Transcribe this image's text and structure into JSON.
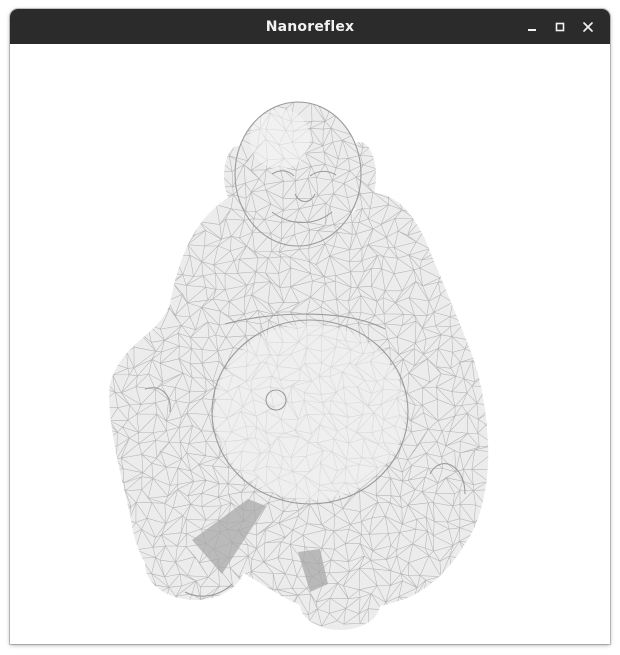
{
  "window": {
    "title": "Nanoreflex",
    "controls": [
      "minimize",
      "maximize",
      "close"
    ],
    "titlebar_color": "#2b2b2b",
    "title_color": "#f2f2f2"
  },
  "viewport": {
    "background": "#ffffff",
    "model": "buddha-statue",
    "render_mode": "wireframe",
    "mesh_color": "#b4b4b4"
  }
}
